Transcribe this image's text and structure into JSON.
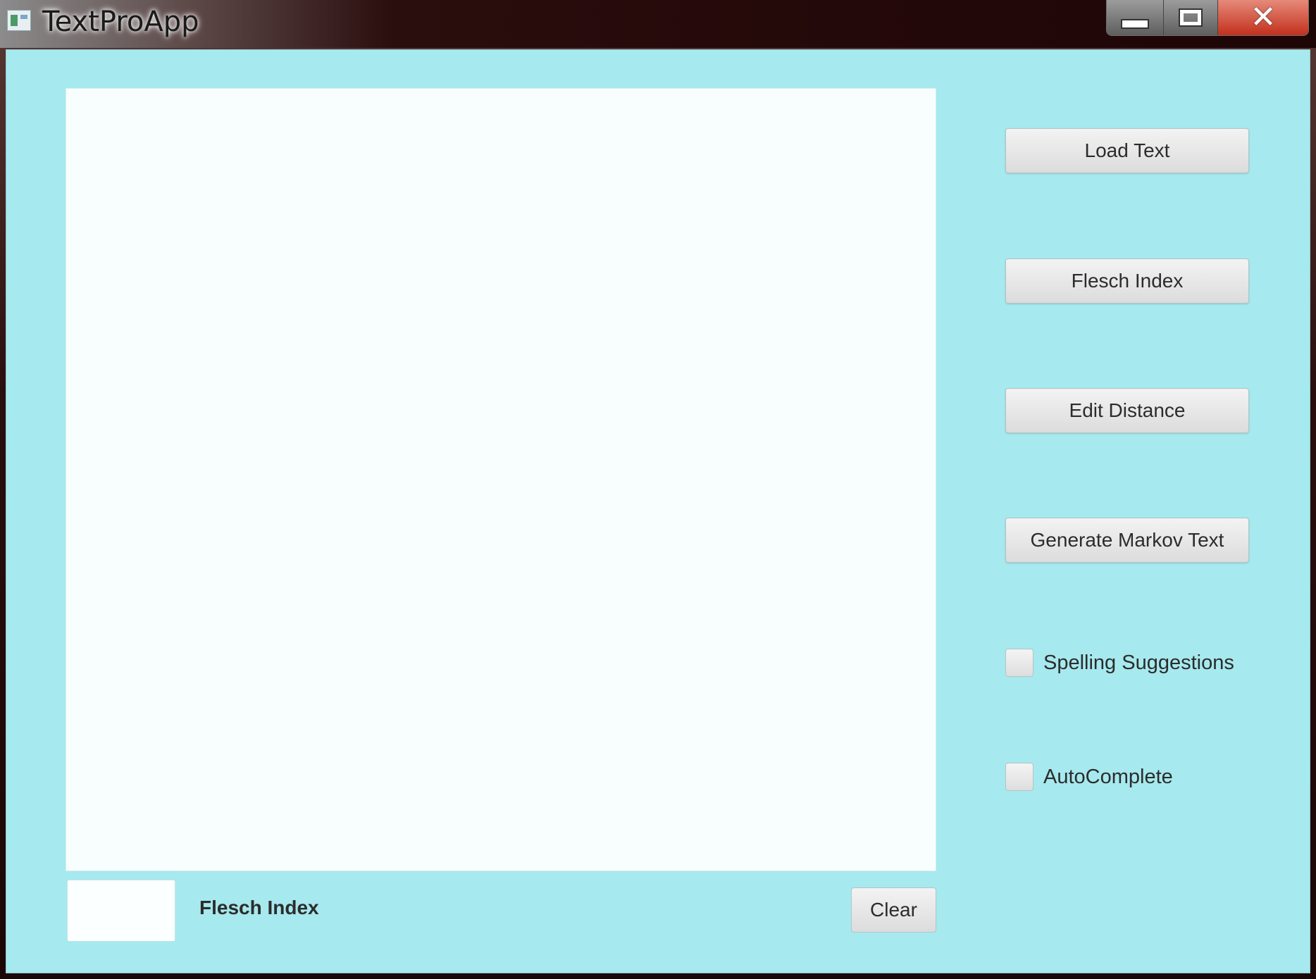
{
  "window": {
    "title": "TextProApp",
    "icon": "app-window-icon",
    "caption_buttons": {
      "minimize": "minimize-icon",
      "maximize": "maximize-icon",
      "close": "close-icon"
    }
  },
  "colors": {
    "client_background": "#a6e9ee",
    "text_area_background": "#f8fefe",
    "close_button": "#c2301c"
  },
  "editor": {
    "text": ""
  },
  "side_panel": {
    "load_text": "Load Text",
    "flesch_index": "Flesch Index",
    "edit_distance": "Edit Distance",
    "generate_markov_text": "Generate Markov Text",
    "spelling_suggestions": {
      "label": "Spelling Suggestions",
      "checked": false
    },
    "autocomplete": {
      "label": "AutoComplete",
      "checked": false
    }
  },
  "bottom_bar": {
    "flesch_value": "",
    "flesch_label": "Flesch Index",
    "clear": "Clear"
  }
}
